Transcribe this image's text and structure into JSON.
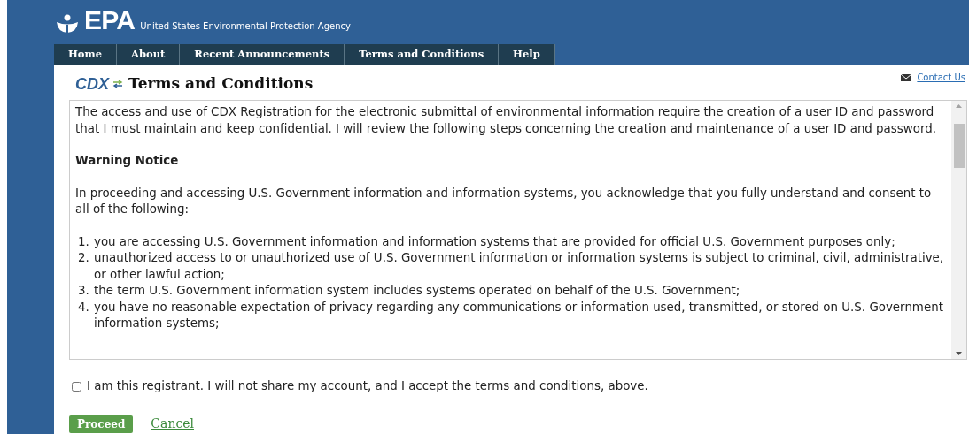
{
  "header": {
    "logo": "EPA",
    "agency": "United States Environmental Protection Agency"
  },
  "nav": [
    {
      "label": "Home",
      "selected": false
    },
    {
      "label": "About",
      "selected": false
    },
    {
      "label": "Recent Announcements",
      "selected": false
    },
    {
      "label": "Terms and Conditions",
      "selected": false
    },
    {
      "label": "Help",
      "selected": false
    }
  ],
  "page": {
    "logo": "CDX",
    "title": "Terms and Conditions",
    "contact_link": "Contact Us"
  },
  "terms": {
    "intro": "The access and use of CDX Registration for the electronic submittal of environmental information require the creation of a user ID and password that I must maintain and keep confidential. I will review the following steps concerning the creation and maintenance of a user ID and password.",
    "heading": "Warning Notice",
    "lead": "In proceeding and accessing U.S. Government information and information systems, you acknowledge that you fully understand and consent to all of the following:",
    "items": [
      {
        "number": "1.",
        "text": "you are accessing U.S. Government information and information systems that are provided for official U.S. Government purposes only;"
      },
      {
        "number": "2.",
        "text": "unauthorized access to or unauthorized use of U.S. Government information or information systems is subject to criminal, civil, administrative, or other lawful action;"
      },
      {
        "number": "3.",
        "text": "the term U.S. Government information system includes systems operated on behalf of the U.S. Government;"
      },
      {
        "number": "4.",
        "text": "you have no reasonable expectation of privacy regarding any communications or information used, transmitted, or stored on U.S. Government information systems;"
      }
    ]
  },
  "agreement": {
    "label": "I am this registrant. I will not share my account, and I accept the terms and conditions, above.",
    "checked": false
  },
  "buttons": {
    "proceed": "Proceed",
    "cancel": "Cancel"
  }
}
